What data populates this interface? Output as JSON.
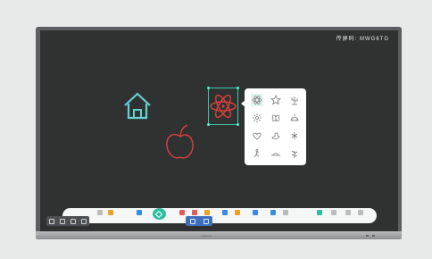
{
  "header": {
    "room_code": "MWG6TG"
  },
  "brand": {
    "name": "maxhub"
  },
  "colors": {
    "accent": "#2bbfa0",
    "selection": "#39c7a9",
    "ink_teal": "#63d3d1",
    "ink_red": "#d9403c"
  },
  "canvas": {
    "objects": [
      "house-icon",
      "atom-shape",
      "apple-sketch"
    ],
    "selected": "atom-shape"
  },
  "shape_panel": {
    "items": [
      {
        "icon": "atom-icon",
        "active": true
      },
      {
        "icon": "star-icon",
        "active": false
      },
      {
        "icon": "cactus-icon",
        "active": false
      },
      {
        "icon": "flower-icon",
        "active": false
      },
      {
        "icon": "butterfly-icon",
        "active": false
      },
      {
        "icon": "dome-icon",
        "active": false
      },
      {
        "icon": "heart-icon",
        "active": false
      },
      {
        "icon": "duck-icon",
        "active": false
      },
      {
        "icon": "bird-icon",
        "active": false
      },
      {
        "icon": "runner-icon",
        "active": false
      },
      {
        "icon": "horizon-icon",
        "active": false
      },
      {
        "icon": "plant-icon",
        "active": false
      }
    ]
  },
  "toolbar": {
    "items": [
      {
        "icon": "undo-icon",
        "color": "#bbb"
      },
      {
        "icon": "folder-icon",
        "color": "#e9a227"
      },
      {
        "icon": "select-icon",
        "color": "#3a8be0"
      },
      {
        "icon": "pen-icon",
        "color": "#2bbfa0"
      },
      {
        "icon": "eraser-icon",
        "color": "#e25b5b"
      },
      {
        "icon": "marker-icon",
        "color": "#e25b5b"
      },
      {
        "icon": "shapes-icon",
        "color": "#e9a227"
      },
      {
        "icon": "text-icon",
        "color": "#3a8be0"
      },
      {
        "icon": "image-icon",
        "color": "#e9a227"
      },
      {
        "icon": "hand-icon",
        "color": "#3a8be0"
      },
      {
        "icon": "undo-icon",
        "color": "#3a8be0"
      },
      {
        "icon": "redo-icon",
        "color": "#bbb"
      },
      {
        "icon": "save-icon",
        "color": "#2bbfa0"
      },
      {
        "icon": "pages-icon",
        "color": "#bbb"
      },
      {
        "icon": "page-count-icon",
        "color": "#bbb"
      },
      {
        "icon": "export-icon",
        "color": "#bbb"
      }
    ]
  }
}
